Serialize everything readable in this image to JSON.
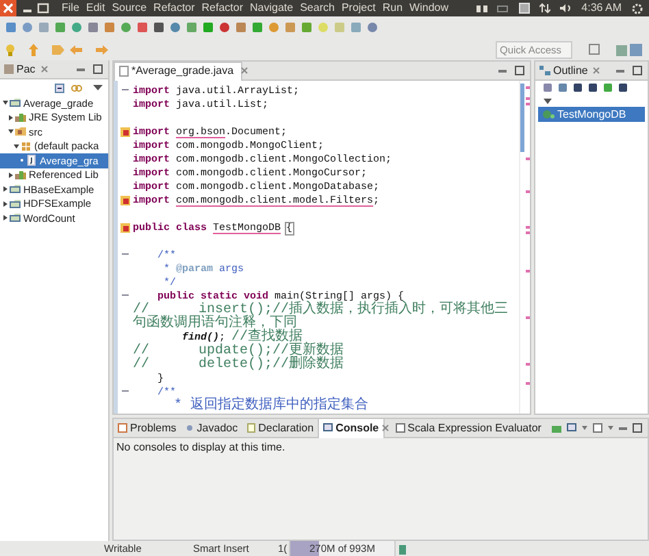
{
  "menubar": {
    "items": [
      "File",
      "Edit",
      "Source",
      "Refactor",
      "Refactor",
      "Navigate",
      "Search",
      "Project",
      "Run",
      "Window"
    ],
    "clock": "4:36 AM"
  },
  "quick_access": {
    "placeholder": "Quick Access"
  },
  "package_explorer": {
    "tab": "Pac",
    "tree": [
      {
        "label": "Average_grade",
        "kind": "project",
        "expanded": true,
        "selected": false,
        "children": [
          {
            "label": "JRE System Lib",
            "kind": "library",
            "expanded": false,
            "selected": false
          },
          {
            "label": "src",
            "kind": "folder",
            "expanded": true,
            "selected": false,
            "children": [
              {
                "label": "(default packa",
                "kind": "package",
                "expanded": true,
                "selected": false,
                "children": [
                  {
                    "label": "Average_gra",
                    "kind": "file",
                    "selected": true
                  }
                ]
              }
            ]
          },
          {
            "label": "Referenced Lib",
            "kind": "library",
            "expanded": false,
            "selected": false
          }
        ]
      },
      {
        "label": "HBaseExample",
        "kind": "project",
        "expanded": false,
        "selected": false
      },
      {
        "label": "HDFSExample",
        "kind": "project",
        "expanded": false,
        "selected": false
      },
      {
        "label": "WordCount",
        "kind": "project",
        "expanded": false,
        "selected": false
      }
    ]
  },
  "editor": {
    "tab": "*Average_grade.java",
    "lines": [
      {
        "fold": true,
        "parts": [
          {
            "kind": "keyword",
            "text": "import "
          },
          {
            "kind": "plain",
            "text": "java.util.ArrayList;"
          }
        ]
      },
      {
        "parts": [
          {
            "kind": "keyword",
            "text": "import "
          },
          {
            "kind": "plain",
            "text": "java.util.List;"
          }
        ]
      },
      {
        "blank_line_before": true,
        "error_marker": true,
        "parts": [
          {
            "kind": "keyword",
            "text": "import "
          },
          {
            "kind": "error",
            "text": "org.bson"
          },
          {
            "kind": "plain",
            "text": ".Document;"
          }
        ]
      },
      {
        "parts": [
          {
            "kind": "keyword",
            "text": "import "
          },
          {
            "kind": "plain",
            "text": "com.mongodb.MongoClient;"
          }
        ]
      },
      {
        "parts": [
          {
            "kind": "keyword",
            "text": "import "
          },
          {
            "kind": "plain",
            "text": "com.mongodb.client.MongoCollection;"
          }
        ]
      },
      {
        "parts": [
          {
            "kind": "keyword",
            "text": "import "
          },
          {
            "kind": "plain",
            "text": "com.mongodb.client.MongoCursor;"
          }
        ]
      },
      {
        "parts": [
          {
            "kind": "keyword",
            "text": "import "
          },
          {
            "kind": "plain",
            "text": "com.mongodb.client.MongoDatabase;"
          }
        ]
      },
      {
        "error_marker": true,
        "parts": [
          {
            "kind": "keyword",
            "text": "import "
          },
          {
            "kind": "error",
            "text": "com.mongodb.client.model.Filters"
          },
          {
            "kind": "plain",
            "text": ";"
          }
        ]
      },
      {
        "blank_line_before": true,
        "error_marker": true,
        "parts": [
          {
            "kind": "keyword",
            "text": "public class "
          },
          {
            "kind": "error",
            "text": "TestMongoDB"
          },
          {
            "kind": "bracket",
            "text": "{"
          }
        ]
      },
      {
        "blank_line_before": true,
        "fold": true,
        "parts": [
          {
            "kind": "javadoc",
            "text": "    /**"
          }
        ]
      },
      {
        "parts": [
          {
            "kind": "javadoc",
            "text": "     * "
          },
          {
            "kind": "tag",
            "text": "@param"
          },
          {
            "kind": "javadoc",
            "text": " args"
          }
        ]
      },
      {
        "parts": [
          {
            "kind": "javadoc",
            "text": "     */"
          }
        ]
      },
      {
        "fold": true,
        "parts": [
          {
            "kind": "keyword",
            "text": "    public static void "
          },
          {
            "kind": "plain",
            "text": "main(String[] args) {"
          }
        ]
      },
      {
        "parts": [
          {
            "kind": "comment",
            "text": "//      insert();//插入数据，执行插入时，可将其他三句函数调用语句注释，下同"
          }
        ]
      },
      {
        "parts": [
          {
            "kind": "call",
            "text": "        find()"
          },
          {
            "kind": "plain",
            "text": "; "
          },
          {
            "kind": "comment",
            "text": "//查找数据"
          }
        ]
      },
      {
        "parts": [
          {
            "kind": "comment",
            "text": "//      update();//更新数据"
          }
        ]
      },
      {
        "parts": [
          {
            "kind": "comment",
            "text": "//      delete();//删除数据"
          }
        ]
      },
      {
        "parts": [
          {
            "kind": "plain",
            "text": "    }"
          }
        ]
      },
      {
        "fold": true,
        "parts": [
          {
            "kind": "javadoc",
            "text": "    /**"
          }
        ]
      },
      {
        "parts": [
          {
            "kind": "javadoc",
            "text": "     * 返回指定数据库中的指定集合"
          }
        ]
      }
    ]
  },
  "outline": {
    "tab": "Outline",
    "items": [
      {
        "label": "TestMongoDB",
        "selected": true
      }
    ]
  },
  "bottom_panel": {
    "tabs": [
      {
        "label": "Problems",
        "selected": false
      },
      {
        "label": "Javadoc",
        "selected": false
      },
      {
        "label": "Declaration",
        "selected": false
      },
      {
        "label": "Console",
        "selected": true
      },
      {
        "label": "Scala Expression Evaluator",
        "selected": false
      }
    ],
    "message": "No consoles to display at this time."
  },
  "status_bar": {
    "mode": "Writable",
    "insert": "Smart Insert",
    "position": "1(",
    "heap": {
      "text": "270M of 993M",
      "level": 0.27
    }
  }
}
